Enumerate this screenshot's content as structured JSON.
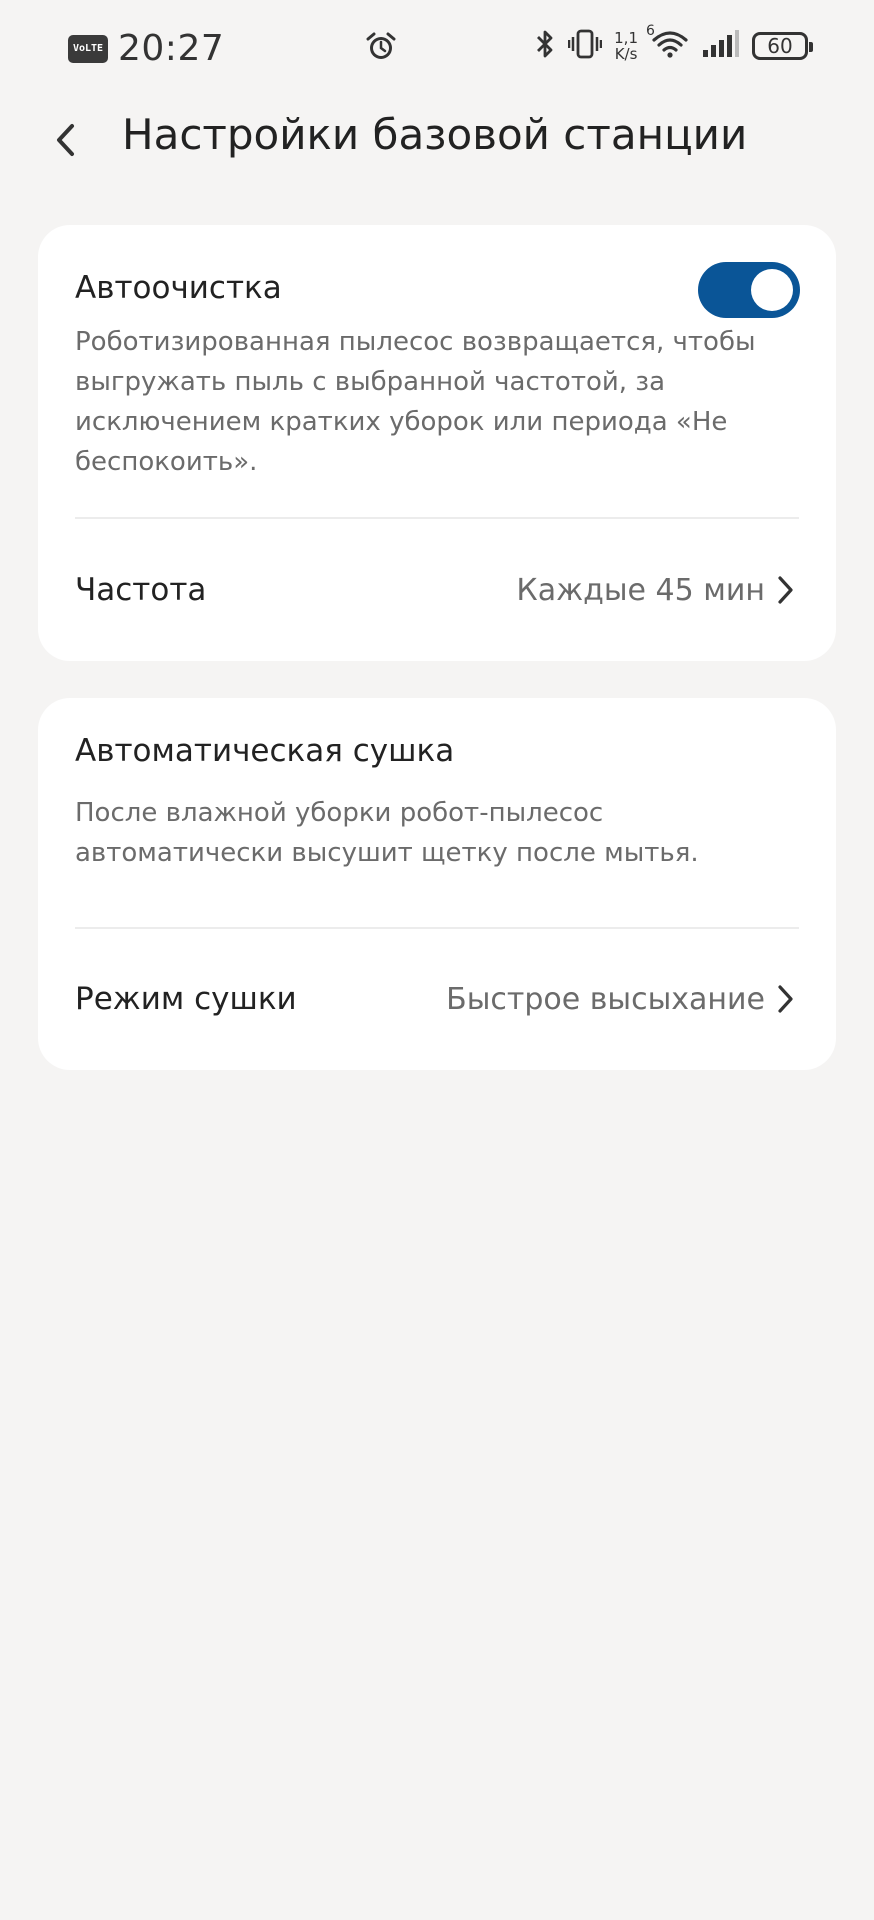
{
  "status_bar": {
    "volte": "VoLTE",
    "time": "20:27",
    "speed_top": "1,1",
    "speed_bottom": "K/s",
    "network": "6",
    "battery": "60"
  },
  "header": {
    "title": "Настройки базовой станции"
  },
  "auto_empty": {
    "title": "Автоочистка",
    "description": "Роботизированная пылесос возвращается, чтобы выгружать пыль с выбранной частотой, за исключением кратких уборок или периода «Не беспокоить».",
    "enabled": true,
    "frequency_label": "Частота",
    "frequency_value": "Каждые 45 мин"
  },
  "auto_dry": {
    "title": "Автоматическая сушка",
    "description": "После влажной уборки робот-пылесос автоматически высушит щетку после мытья.",
    "mode_label": "Режим сушки",
    "mode_value": "Быстрое высыхание"
  },
  "colors": {
    "accent": "#0a5597",
    "background": "#f5f4f3",
    "card": "#ffffff",
    "secondary_text": "#6b6b6b"
  }
}
